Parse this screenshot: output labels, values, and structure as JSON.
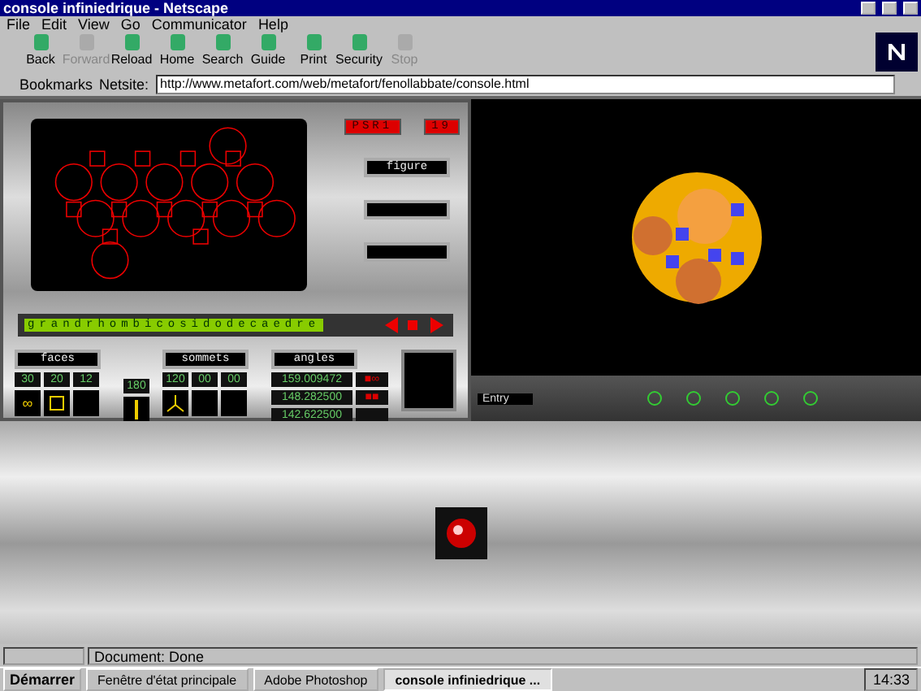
{
  "window": {
    "title": "console infiniedrique - Netscape"
  },
  "menu": [
    "File",
    "Edit",
    "View",
    "Go",
    "Communicator",
    "Help"
  ],
  "toolbar": [
    {
      "label": "Back",
      "disabled": false
    },
    {
      "label": "Forward",
      "disabled": true
    },
    {
      "label": "Reload",
      "disabled": false
    },
    {
      "label": "Home",
      "disabled": false
    },
    {
      "label": "Search",
      "disabled": false
    },
    {
      "label": "Guide",
      "disabled": false
    },
    {
      "label": "Print",
      "disabled": false
    },
    {
      "label": "Security",
      "disabled": false
    },
    {
      "label": "Stop",
      "disabled": true
    }
  ],
  "location": {
    "bookmarks": "Bookmarks",
    "netsite_label": "Netsite:",
    "url": "http://www.metafort.com/web/metafort/fenollabbate/console.html"
  },
  "console": {
    "display_1": "PSR1",
    "display_2": "19",
    "figure_label": "figure",
    "name": "grandrhombicosidodecaedre",
    "faces_label": "faces",
    "face_counts": [
      "30",
      "20",
      "12"
    ],
    "edges": "180",
    "sommets_label": "sommets",
    "vertex_counts": [
      "120",
      "00",
      "00"
    ],
    "angles_label": "angles",
    "angles": [
      {
        "value": "159.009472",
        "tag": "■∞"
      },
      {
        "value": "148.282500",
        "tag": "■■"
      },
      {
        "value": "142.622500"
      }
    ],
    "face_symbol": "∞"
  },
  "viewer": {
    "entry": "Entry"
  },
  "status_bar": {
    "text": "Document: Done"
  },
  "taskbar": {
    "start": "Démarrer",
    "tasks": [
      {
        "label": "Fenêtre d'état principale",
        "selected": false
      },
      {
        "label": "Adobe Photoshop",
        "selected": false
      },
      {
        "label": "console infiniedrique ...",
        "selected": true
      }
    ],
    "clock": "14:33"
  }
}
